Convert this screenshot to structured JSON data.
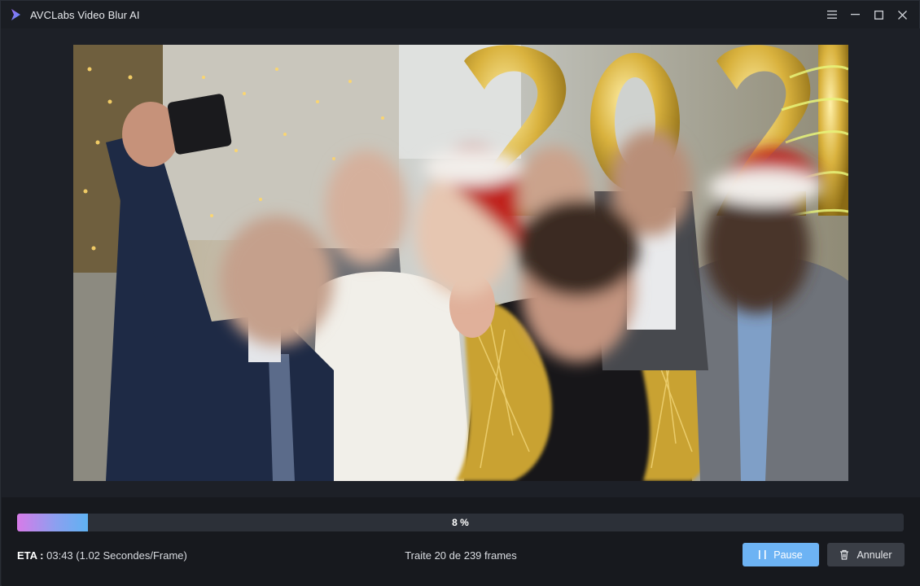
{
  "window": {
    "title": "AVCLabs Video Blur AI",
    "logo_icon": "avclabs-logo-icon",
    "controls": [
      "menu-icon",
      "minimize-icon",
      "maximize-icon",
      "close-icon"
    ]
  },
  "preview": {
    "description_icon": "video-frame-preview"
  },
  "progress": {
    "percent": 8,
    "label": "8 %",
    "fill_colors": [
      "#d77be8",
      "#5fb2f2"
    ]
  },
  "status": {
    "eta_label": "ETA :",
    "eta_value": "03:43 (1.02 Secondes/Frame)",
    "frames_text": "Traite 20 de 239 frames"
  },
  "actions": {
    "pause_label": "Pause",
    "pause_icon": "pause-icon",
    "cancel_label": "Annuler",
    "cancel_icon": "trash-icon"
  },
  "colors": {
    "accent": "#6db3f4",
    "background": "#1d2027",
    "panel": "#17191e"
  }
}
